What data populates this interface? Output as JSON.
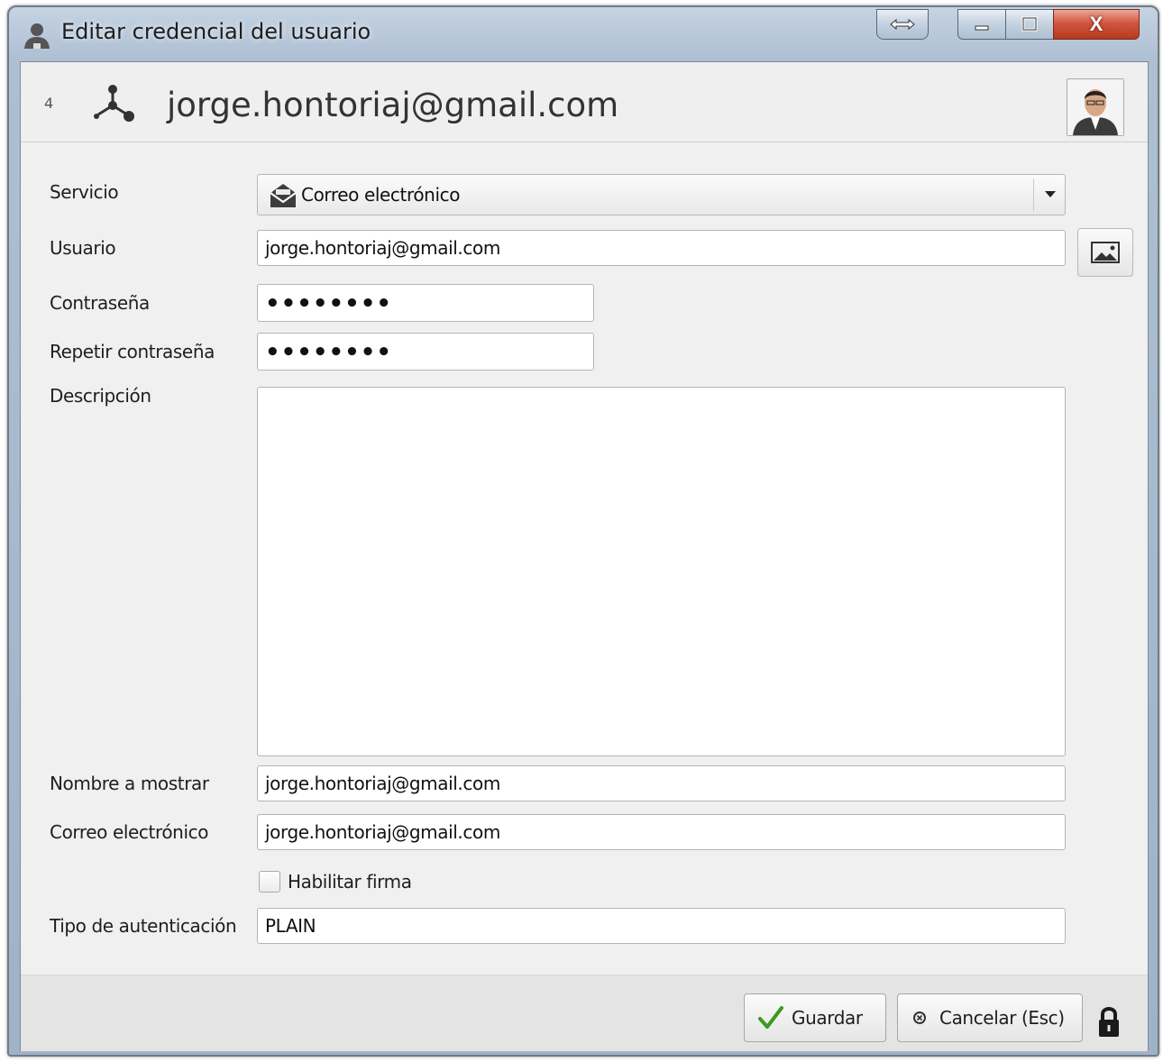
{
  "window": {
    "title": "Editar credencial del usuario"
  },
  "header": {
    "number": "4",
    "title": "jorge.hontoriaj@gmail.com"
  },
  "form": {
    "service_label": "Servicio",
    "service_value": "Correo electrónico",
    "user_label": "Usuario",
    "user_value": "jorge.hontoriaj@gmail.com",
    "password_label": "Contraseña",
    "password_value": "••••••••",
    "repeat_password_label": "Repetir contraseña",
    "repeat_password_value": "••••••••",
    "description_label": "Descripción",
    "description_value": "",
    "display_name_label": "Nombre a mostrar",
    "display_name_value": "jorge.hontoriaj@gmail.com",
    "email_label": "Correo electrónico",
    "email_value": "jorge.hontoriaj@gmail.com",
    "signature_label": "Habilitar firma",
    "signature_checked": false,
    "auth_type_label": "Tipo de autenticación",
    "auth_type_value": "PLAIN"
  },
  "footer": {
    "save_label": "Guardar",
    "cancel_label": "Cancelar (Esc)"
  },
  "icons": {
    "window": "user-icon",
    "header": "network-icon",
    "service": "envelope-icon",
    "picture": "picture-icon",
    "save": "checkmark-icon",
    "cancel": "cancel-icon",
    "lock": "lock-icon"
  },
  "colors": {
    "titlebar": "#aebfd3",
    "close_button": "#d2563e",
    "save_check": "#3c9a1e"
  }
}
